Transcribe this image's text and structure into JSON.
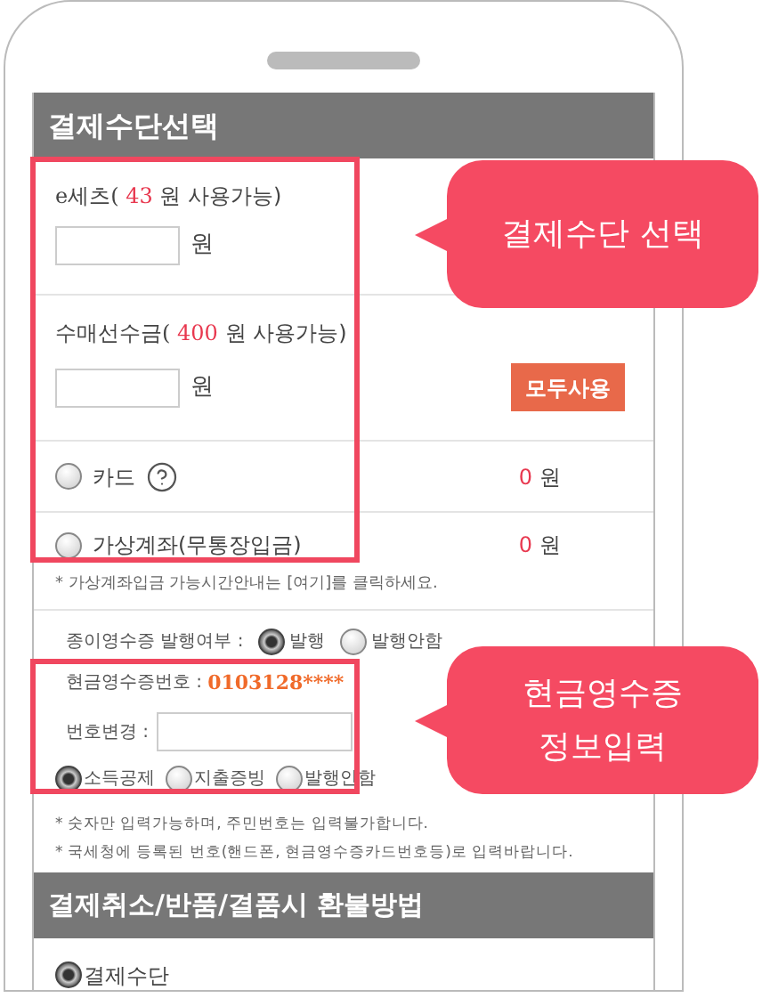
{
  "section_title": "결제수단선택",
  "balances": [
    {
      "label_prefix": "e세츠(",
      "amount": "43",
      "label_suffix": "원 사용가능)",
      "unit": "원"
    },
    {
      "label_prefix": "수매선수금(",
      "amount": "400",
      "label_suffix": "원 사용가능)",
      "unit": "원",
      "button": "모두사용"
    }
  ],
  "payment_methods": [
    {
      "label": "카드",
      "help": true,
      "amount": "0",
      "unit": "원",
      "selected": false
    },
    {
      "label": "가상계좌(무통장입금)",
      "help": false,
      "amount": "0",
      "unit": "원",
      "selected": false
    }
  ],
  "transfer_note": "* 가상계좌입금 가능시간안내는 [여기]를 클릭하세요.",
  "paper_receipt": {
    "label": "종이영수증 발행여부 :",
    "options": [
      {
        "label": "발행",
        "selected": true
      },
      {
        "label": "발행안함",
        "selected": false
      }
    ]
  },
  "cash_receipt": {
    "number_label": "현금영수증번호 :",
    "number": "0103128****",
    "change_label": "번호변경 :",
    "options": [
      {
        "label": "소득공제",
        "selected": true
      },
      {
        "label": "지출증빙",
        "selected": false
      },
      {
        "label": "발행안함",
        "selected": false
      }
    ]
  },
  "notes": [
    "* 숫자만 입력가능하며, 주민번호는 입력불가합니다.",
    "* 국세청에 등록된 번호(핸드폰, 현금영수증카드번호등)로 입력바랍니다."
  ],
  "refund": {
    "title": "결제취소/반품/결품시 환불방법",
    "options": [
      {
        "label": "결제수단",
        "selected": true
      }
    ]
  },
  "callouts": [
    "결제수단 선택",
    "현금영수증\n정보입력"
  ]
}
